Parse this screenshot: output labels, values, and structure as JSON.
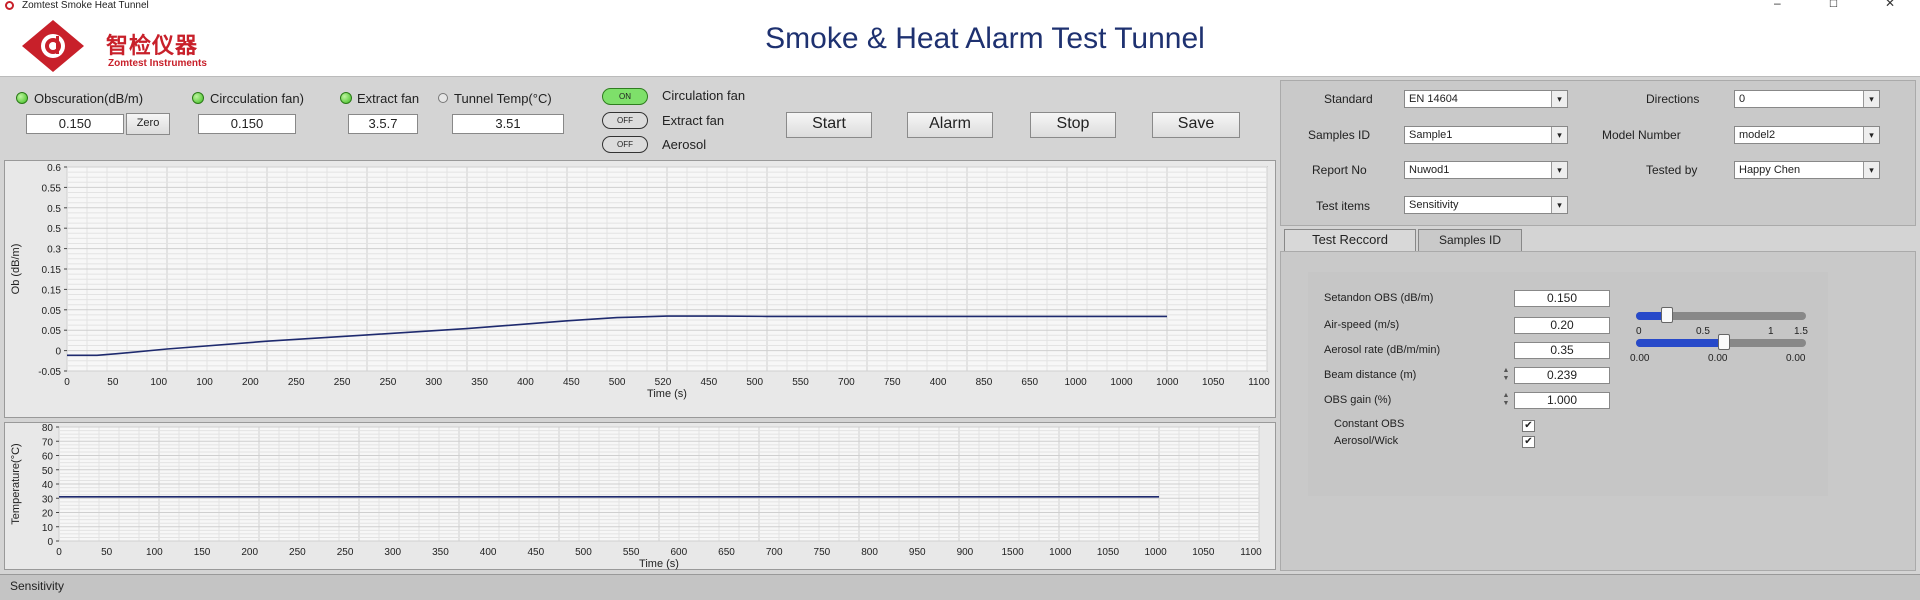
{
  "window": {
    "title": "Zomtest Smoke Heat Tunnel",
    "min": "–",
    "max": "☐",
    "close": "✕"
  },
  "header": {
    "logo_cn": "智检仪器",
    "logo_en": "Zomtest Instruments",
    "title": "Smoke & Heat Alarm Test Tunnel"
  },
  "indicators": [
    {
      "label": "Obscuration(dB/m)",
      "on": true,
      "value": "0.150"
    },
    {
      "label": "Circculation fan)",
      "on": true,
      "value": "0.150"
    },
    {
      "label": "Extract fan",
      "on": true,
      "value": "3.5.7"
    },
    {
      "label": "Tunnel Temp(°C)",
      "on": false,
      "value": "3.51"
    }
  ],
  "zero_button": "Zero",
  "toggles": [
    {
      "state": "ON",
      "label": "Circulation fan",
      "on": true
    },
    {
      "state": "OFF",
      "label": "Extract fan",
      "on": false
    },
    {
      "state": "OFF",
      "label": "Aerosol",
      "on": false
    }
  ],
  "buttons": {
    "start": "Start",
    "alarm": "Alarm",
    "stop": "Stop",
    "save": "Save"
  },
  "obs_chart": {
    "ylabel": "Ob (dB/m)",
    "xlabel": "Time (s)",
    "yticks": [
      "0.6",
      "0.55",
      "0.5",
      "0.5",
      "0.3",
      "0.15",
      "0.15",
      "0.05",
      "0.05",
      "0",
      "-0.05"
    ],
    "xticks": [
      "0",
      "50",
      "100",
      "100",
      "200",
      "250",
      "250",
      "250",
      "300",
      "350",
      "400",
      "450",
      "500",
      "520",
      "450",
      "500",
      "550",
      "700",
      "750",
      "400",
      "850",
      "650",
      "1000",
      "1000",
      "1000",
      "1050",
      "1100"
    ]
  },
  "temp_chart": {
    "ylabel": "Temperature(°C)",
    "xlabel": "Time (s)",
    "yticks": [
      "80",
      "70",
      "60",
      "50",
      "40",
      "30",
      "20",
      "10",
      "0"
    ],
    "xticks": [
      "0",
      "50",
      "100",
      "150",
      "200",
      "250",
      "250",
      "300",
      "350",
      "400",
      "450",
      "500",
      "550",
      "600",
      "650",
      "700",
      "750",
      "800",
      "950",
      "900",
      "1500",
      "1000",
      "1050",
      "1000",
      "1050",
      "1100"
    ]
  },
  "chart_data": [
    {
      "type": "line",
      "xlabel": "Time (s)",
      "ylabel": "Ob (dB/m)",
      "ylim": [
        -0.05,
        0.6
      ],
      "x": [
        0,
        30,
        50,
        100,
        200,
        300,
        400,
        500,
        550,
        600,
        650,
        700,
        750,
        800,
        900,
        1000,
        1100
      ],
      "series": [
        {
          "values": [
            0,
            0.0,
            0.005,
            0.02,
            0.045,
            0.065,
            0.085,
            0.11,
            0.12,
            0.125,
            0.125,
            0.124,
            0.124,
            0.124,
            0.124,
            0.124,
            0.124
          ]
        }
      ]
    },
    {
      "type": "line",
      "xlabel": "Time (s)",
      "ylabel": "Temperature(°C)",
      "ylim": [
        0,
        80
      ],
      "x": [
        0,
        200,
        400,
        600,
        800,
        1000,
        1100
      ],
      "series": [
        {
          "values": [
            31,
            31,
            31,
            31,
            31,
            31,
            31
          ]
        }
      ]
    }
  ],
  "settings": {
    "standard": {
      "label": "Standard",
      "value": "EN 14604"
    },
    "directions": {
      "label": "Directions",
      "value": "0"
    },
    "samples_id": {
      "label": "Samples ID",
      "value": "Sample1"
    },
    "model_number": {
      "label": "Model Number",
      "value": "model2"
    },
    "report_no": {
      "label": "Report No",
      "value": "Nuwod1"
    },
    "tested_by": {
      "label": "Tested by",
      "value": "Happy Chen"
    },
    "test_items": {
      "label": "Test items",
      "value": "Sensitivity"
    }
  },
  "tabs": [
    "Test Reccord",
    "Samples ID"
  ],
  "params": [
    {
      "label": "Setandon OBS (dB/m)",
      "value": "0.150"
    },
    {
      "label": "Air-speed (m/s)",
      "value": "0.20"
    },
    {
      "label": "Aerosol rate (dB/m/min)",
      "value": "0.35"
    },
    {
      "label": "Beam distance (m)",
      "value": "0.239"
    },
    {
      "label": "OBS gain (%)",
      "value": "1.000"
    }
  ],
  "checks": [
    {
      "label": "Constant OBS",
      "checked": true
    },
    {
      "label": "Aerosol/Wick",
      "checked": true
    }
  ],
  "slider_scale": {
    "ticks": [
      "0",
      "0.5",
      "1",
      "1.5"
    ],
    "readouts": [
      "0.00",
      "0.00",
      "0.00"
    ]
  },
  "sliders": [
    {
      "level": 0.18
    },
    {
      "level": 0.52
    }
  ],
  "status": {
    "text": "Sensitivity"
  }
}
